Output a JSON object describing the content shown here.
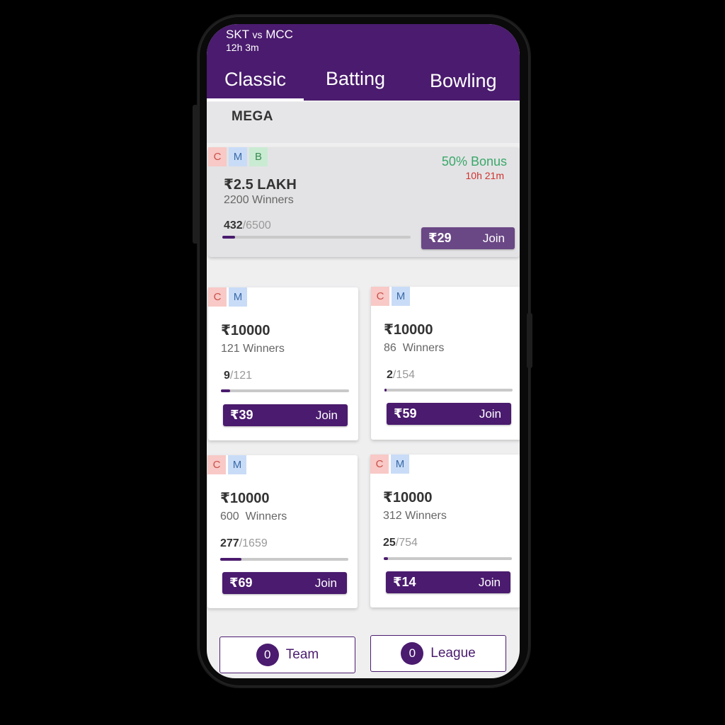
{
  "header": {
    "team_a": "SKT",
    "vs": "vs",
    "team_b": "MCC",
    "time_left": "12h 3m"
  },
  "tabs": [
    {
      "label": "Classic",
      "active": true
    },
    {
      "label": "Batting",
      "active": false
    },
    {
      "label": "Bowling",
      "active": false
    }
  ],
  "section_title": "MEGA",
  "badge_letters": {
    "c": "C",
    "m": "M",
    "b": "B"
  },
  "mega_contest": {
    "bonus": "50% Bonus",
    "bonus_time": "10h 21m",
    "prize": "₹2.5 LAKH",
    "winners": "2200 Winners",
    "filled": "432",
    "total": "6500",
    "fill_fraction": 0.066,
    "fee": "₹29",
    "join_label": "Join"
  },
  "contests": [
    {
      "prize": "₹10000",
      "winners": "121 Winners",
      "filled": "9",
      "total": "121",
      "fill_fraction": 0.074,
      "fee": "₹39",
      "join_label": "Join"
    },
    {
      "prize": "₹10000",
      "winners": "86  Winners",
      "filled": "2",
      "total": "154",
      "fill_fraction": 0.013,
      "fee": "₹59",
      "join_label": "Join"
    },
    {
      "prize": "₹10000",
      "winners": "600  Winners",
      "filled": "277",
      "total": "1659",
      "fill_fraction": 0.167,
      "fee": "₹69",
      "join_label": "Join"
    },
    {
      "prize": "₹10000",
      "winners": "312 Winners",
      "filled": "25",
      "total": "754",
      "fill_fraction": 0.033,
      "fee": "₹14",
      "join_label": "Join"
    }
  ],
  "bottom_bar": {
    "team_count": "0",
    "team_label": "Team",
    "league_count": "0",
    "league_label": "League"
  },
  "colors": {
    "brand": "#4a1b6e",
    "bonus": "#3aa86b",
    "timer": "#d0322e"
  }
}
